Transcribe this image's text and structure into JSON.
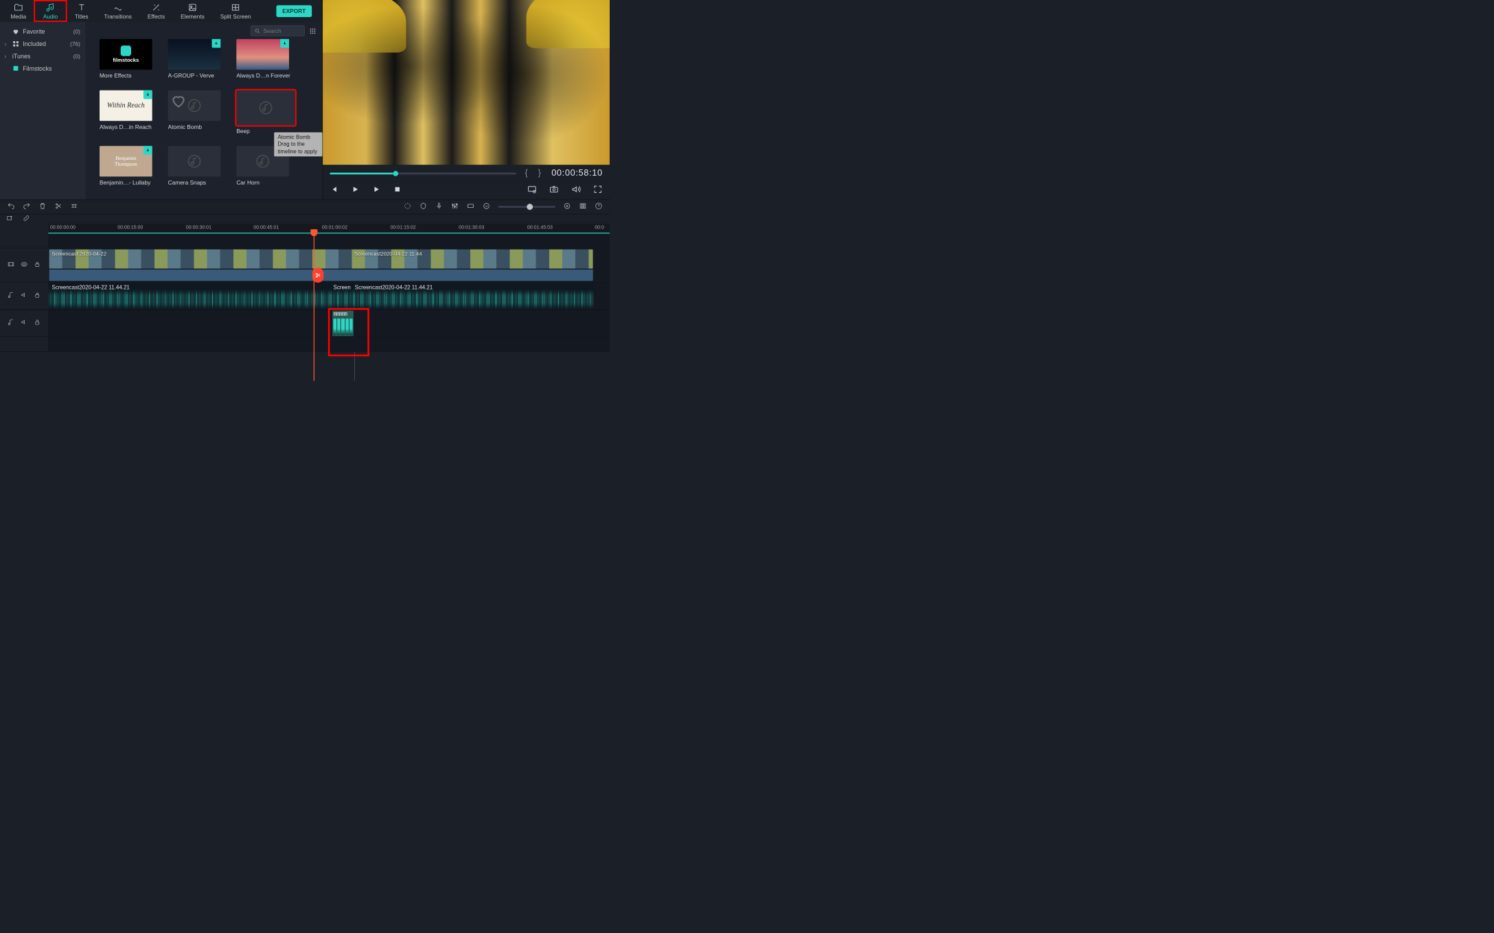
{
  "tabs": {
    "media": "Media",
    "audio": "Audio",
    "titles": "Titles",
    "transitions": "Transitions",
    "effects": "Effects",
    "elements": "Elements",
    "split_screen": "Split Screen"
  },
  "export_label": "EXPORT",
  "sidebar": {
    "favorite": {
      "label": "Favorite",
      "count": "(0)"
    },
    "included": {
      "label": "Included",
      "count": "(76)"
    },
    "itunes": {
      "label": "iTunes",
      "count": "(0)"
    },
    "filmstocks": {
      "label": "Filmstocks"
    }
  },
  "search": {
    "placeholder": "Search"
  },
  "cards": {
    "more_effects": "More Effects",
    "verve": "A-GROUP - Verve",
    "forever": "Always D…n Forever",
    "within_reach": "Always D…in Reach",
    "atomic_bomb": "Atomic Bomb",
    "beep": "Beep",
    "benjamin": "Benjamin…- Lullaby",
    "camera_snaps": "Camera Snaps",
    "car_horn": "Car Horn",
    "filmstocks_brand": "filmstocks",
    "withinreach_text": "Within Reach",
    "benjamin_text1": "Benjamin",
    "benjamin_text2": "Thompson"
  },
  "tooltip": {
    "title": "Atomic Bomb",
    "hint": "Drag to the timeline to apply"
  },
  "preview": {
    "timecode": "00:00:58:10"
  },
  "ruler": {
    "t0": "00:00:00:00",
    "t1": "00:00:15:00",
    "t2": "00:00:30:01",
    "t3": "00:00:45:01",
    "t4": "00:01:00:02",
    "t5": "00:01:15:02",
    "t6": "00:01:30:03",
    "t7": "00:01:45:03",
    "t8": "00:0"
  },
  "clips": {
    "video_a": "Screencast 2020-04-22",
    "video_b": "Screencast2020-04-22 11.44",
    "audio_a": "Screencast2020-04-22 11.44.21",
    "audio_b": "Screen",
    "audio_c": "Screencast2020-04-22 11.44.21",
    "beep": "BBBBB"
  }
}
